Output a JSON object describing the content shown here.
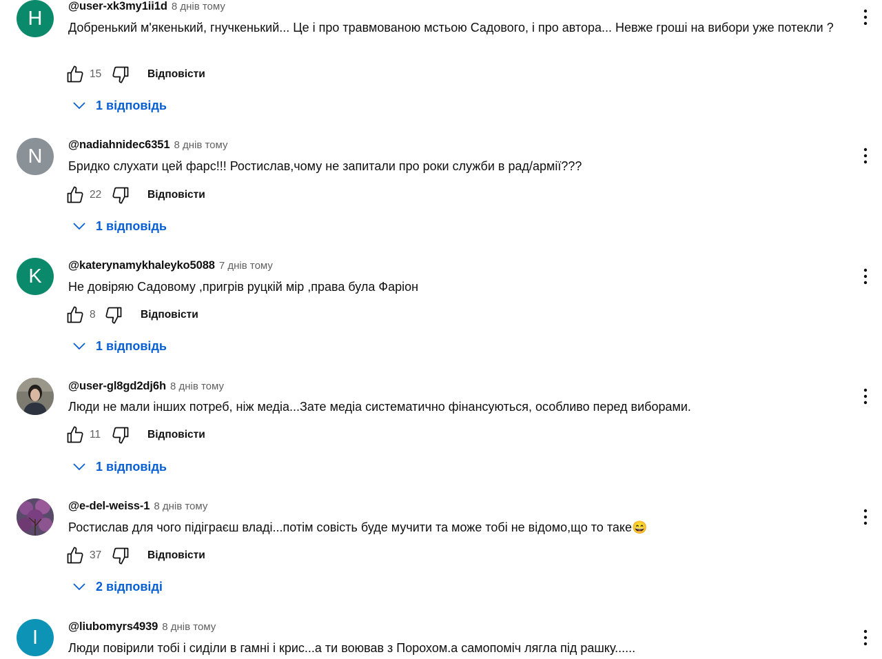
{
  "ui": {
    "reply_label": "Відповісти",
    "reply_link_color": "#065fd4"
  },
  "comments": [
    {
      "avatar_letter": "H",
      "avatar_color": "#0b8a6b",
      "author": "@user-xk3my1ii1d",
      "time": "8 днів тому",
      "text": "Добренький м'якенький, гнучкенький... Це і про травмованою мстьою Садового,  і про автора... Невже гроші  на вибори уже потекли ?",
      "likes": "15",
      "replies": "1 відповідь"
    },
    {
      "avatar_letter": "N",
      "avatar_color": "#8a9197",
      "author": "@nadiahnidec6351",
      "time": "8 днів тому",
      "text": "Бридко слухати цей фарс!!! Ростислав,чому не запитали про роки служби в рад/армії???",
      "likes": "22",
      "replies": "1 відповідь"
    },
    {
      "avatar_letter": "K",
      "avatar_color": "#0b8a6b",
      "author": "@katerynamykhaleyko5088",
      "time": "7 днів тому",
      "text": "Не довіряю Садовому ,пригрів руцкій мір ,права була Фаріон",
      "likes": "8",
      "replies": "1 відповідь"
    },
    {
      "avatar_letter": "",
      "avatar_color": "#7a7a6e",
      "author": "@user-gl8gd2dj6h",
      "time": "8 днів тому",
      "text": "Люди не мали інших потреб, ніж медіа...Зате медіа систематично фінансуються, особливо перед виборами.",
      "likes": "11",
      "replies": "1 відповідь"
    },
    {
      "avatar_letter": "",
      "avatar_color": "#6a3f6e",
      "author": "@e-del-weiss-1",
      "time": "8 днів тому",
      "text": "Ростислав для чого підіграєш владі...потім совість буде мучити та може тобі не відомо,що то таке😄",
      "likes": "37",
      "replies": "2 відповіді"
    },
    {
      "avatar_letter": "I",
      "avatar_color": "#0d93b5",
      "author": "@liubomyrs4939",
      "time": "8 днів тому",
      "text": "Люди повірили тобі і сиділи в гамні і крис...а ти воював з Порохом.а самопоміч лягла під рашку......",
      "likes": "",
      "replies": ""
    }
  ]
}
